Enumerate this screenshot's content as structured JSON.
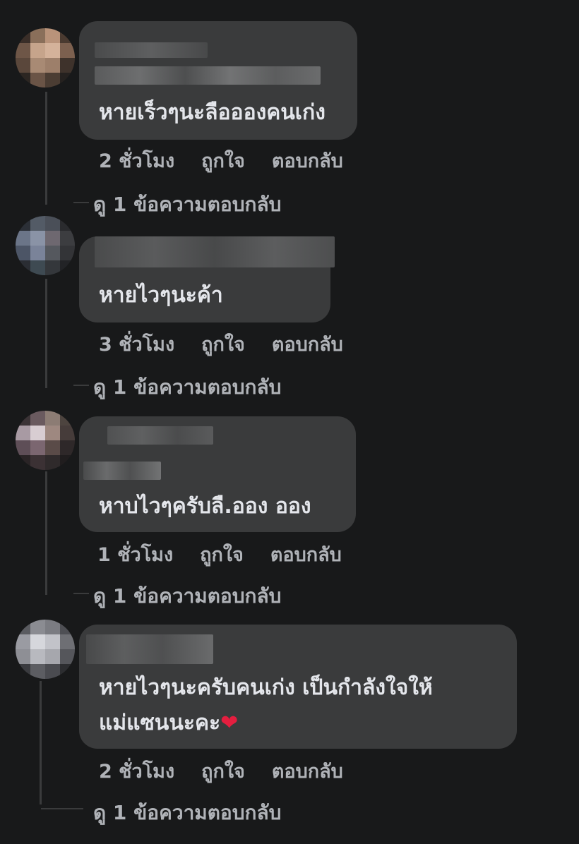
{
  "comments": [
    {
      "text": "หายเร็วๆนะลืออองคนเก่ง",
      "time": "2 ชั่วโมง",
      "like": "ถูกใจ",
      "reply": "ตอบกลับ",
      "view_replies": "ดู 1 ข้อความตอบกลับ"
    },
    {
      "text": "หายไวๆนะค้า",
      "time": "3 ชั่วโมง",
      "like": "ถูกใจ",
      "reply": "ตอบกลับ",
      "view_replies": "ดู 1 ข้อความตอบกลับ"
    },
    {
      "text": "หาบไวๆครับลื.ออง ออง",
      "time": "1 ชั่วโมง",
      "like": "ถูกใจ",
      "reply": "ตอบกลับ",
      "view_replies": "ดู 1 ข้อความตอบกลับ"
    },
    {
      "text_line1": "หายไวๆนะครับคนเก่ง เป็นกำลังใจให้",
      "text_line2": "แม่แซนนะคะ",
      "emoji": "❤",
      "time": "2 ชั่วโมง",
      "like": "ถูกใจ",
      "reply": "ตอบกลับ",
      "view_replies": "ดู 1 ข้อความตอบกลับ"
    }
  ],
  "colors": {
    "background": "#18191a",
    "bubble": "#3a3b3c",
    "text": "#e4e6eb",
    "secondary_text": "#b0b3b8",
    "heart": "#e41e3f"
  }
}
